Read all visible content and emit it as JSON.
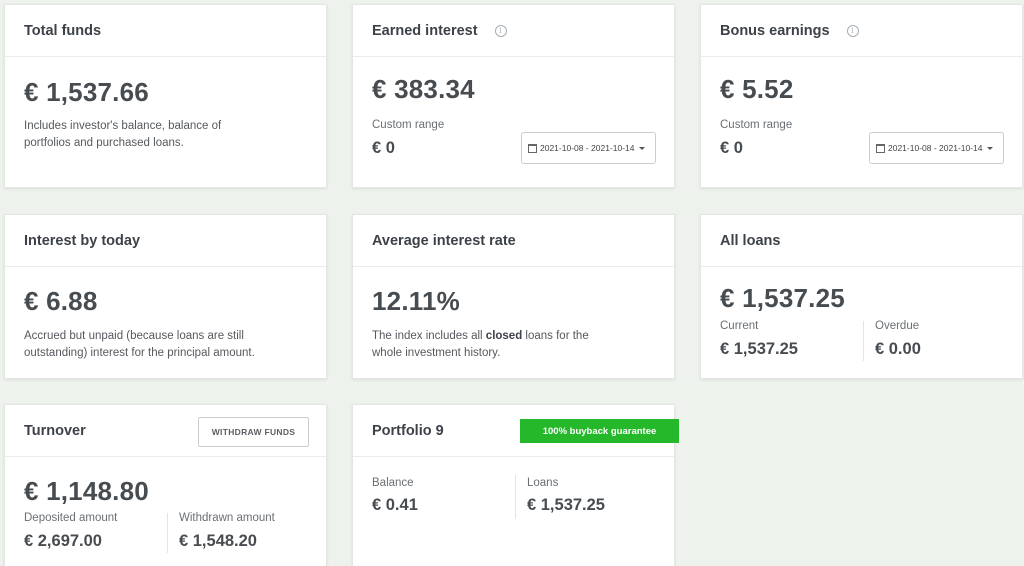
{
  "total_funds": {
    "title": "Total funds",
    "value": "€ 1,537.66",
    "desc_line1": "Includes investor's balance, balance of",
    "desc_line2": "portfolios and purchased loans."
  },
  "earned_interest": {
    "title": "Earned interest",
    "value": "€ 383.34",
    "range_label": "Custom range",
    "range_value": "€ 0",
    "date_range": "2021-10-08 - 2021-10-14"
  },
  "bonus_earnings": {
    "title": "Bonus earnings",
    "value": "€ 5.52",
    "range_label": "Custom range",
    "range_value": "€ 0",
    "date_range": "2021-10-08 - 2021-10-14"
  },
  "interest_by_today": {
    "title": "Interest by today",
    "value": "€ 6.88",
    "desc_line1": "Accrued but unpaid (because loans are still",
    "desc_line2": "outstanding) interest for the principal amount."
  },
  "average_interest_rate": {
    "title": "Average interest rate",
    "value": "12.11%",
    "desc_pre": "The index includes all ",
    "desc_bold": "closed",
    "desc_post": " loans for the",
    "desc_line2": "whole investment history."
  },
  "all_loans": {
    "title": "All loans",
    "value": "€ 1,537.25",
    "current_label": "Current",
    "current_value": "€ 1,537.25",
    "overdue_label": "Overdue",
    "overdue_value": "€ 0.00"
  },
  "turnover": {
    "title": "Turnover",
    "withdraw_button": "WITHDRAW FUNDS",
    "value": "€ 1,148.80",
    "deposited_label": "Deposited amount",
    "deposited_value": "€ 2,697.00",
    "withdrawn_label": "Withdrawn amount",
    "withdrawn_value": "€ 1,548.20"
  },
  "portfolio": {
    "title": "Portfolio 9",
    "badge": "100% buyback guarantee",
    "balance_label": "Balance",
    "balance_value": "€ 0.41",
    "loans_label": "Loans",
    "loans_value": "€ 1,537.25"
  },
  "colors": {
    "background": "#eef2ed",
    "card": "#ffffff",
    "badge_green": "#25b82a",
    "text_dark": "#3d4248"
  }
}
